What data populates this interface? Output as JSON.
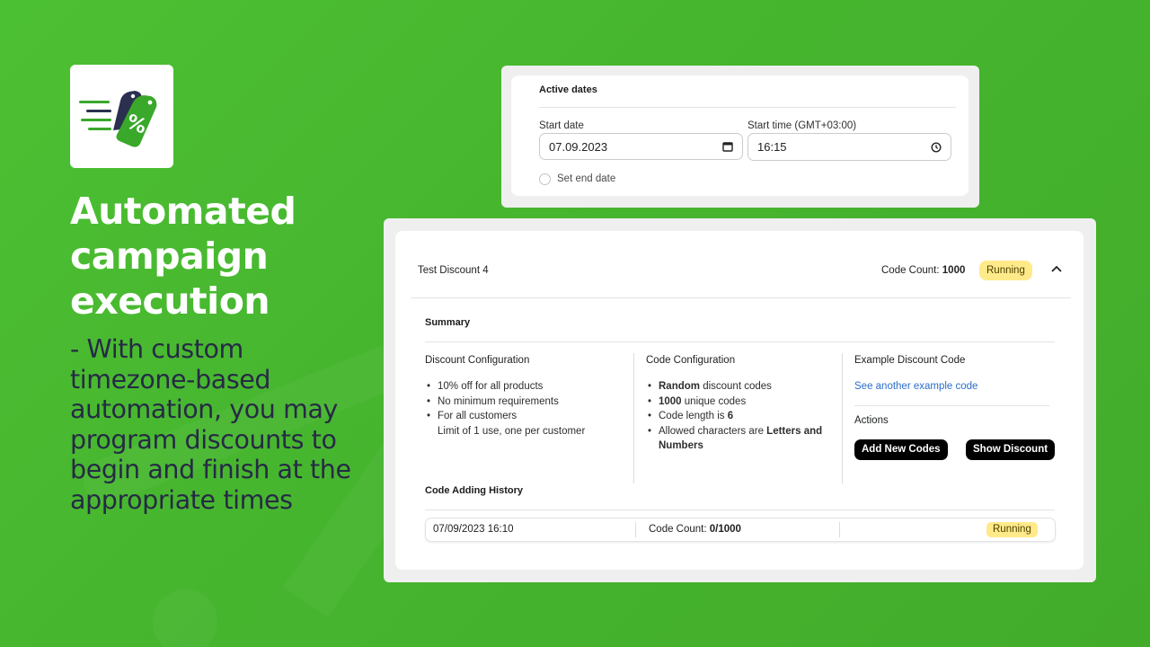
{
  "colors": {
    "background_green": "#47b62f",
    "headline": "#ffffff",
    "subtext": "#262a45",
    "badge_bg": "#ffea8a",
    "link": "#2c6ecb",
    "button_bg": "#000000"
  },
  "hero": {
    "logo_icon": "discount-tags-icon",
    "headline": "Automated campaign execution",
    "subtext": "- With custom timezone-based automation, you may program discounts to begin and finish at the appropriate times"
  },
  "active_dates": {
    "title": "Active dates",
    "start_date_label": "Start date",
    "start_date_value": "07.09.2023",
    "start_time_label": "Start time (GMT+03:00)",
    "start_time_value": "16:15",
    "set_end_date_label": "Set end date"
  },
  "discount": {
    "name": "Test Discount 4",
    "code_count_label": "Code Count:",
    "code_count_value": "1000",
    "status": "Running",
    "summary_title": "Summary",
    "discount_config": {
      "title": "Discount Configuration",
      "items": [
        "10% off for all products",
        "No minimum requirements",
        "For all customers",
        "Limit of 1 use, one per customer"
      ]
    },
    "code_config": {
      "title": "Code Configuration",
      "items": [
        {
          "bold": "Random",
          "rest": " discount codes"
        },
        {
          "bold": "1000",
          "rest": " unique codes"
        },
        {
          "pre": "Code length is ",
          "bold": "6"
        },
        {
          "pre": "Allowed characters are ",
          "bold": "Letters and",
          "bold2": "Numbers"
        }
      ]
    },
    "example": {
      "title": "Example Discount Code",
      "link": "See another example code"
    },
    "actions": {
      "title": "Actions",
      "add_codes": "Add New Codes",
      "show_discount": "Show Discount"
    },
    "history": {
      "title": "Code Adding History",
      "rows": [
        {
          "date": "07/09/2023 16:10",
          "count_label": "Code Count:",
          "count_value": "0/1000",
          "status": "Running"
        }
      ]
    }
  }
}
